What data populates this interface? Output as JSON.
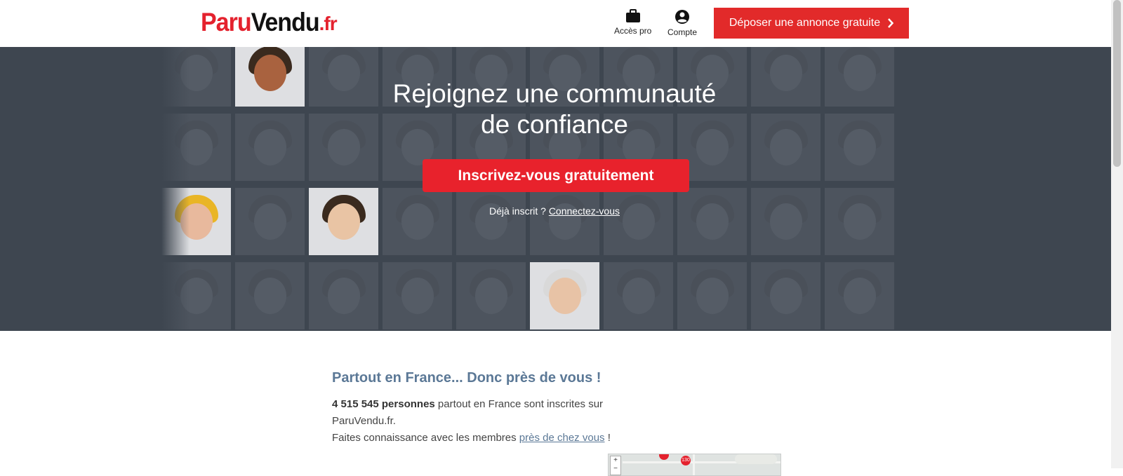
{
  "header": {
    "logo": {
      "part1": "Paru",
      "part2": "Vendu",
      "part3": ".fr"
    },
    "pro_label": "Accès pro",
    "account_label": "Compte",
    "deposit_label": "Déposer une annonce gratuite"
  },
  "hero": {
    "title_line1": "Rejoignez une communauté",
    "title_line2": "de confiance",
    "signup_label": "Inscrivez-vous gratuitement",
    "already_text": "Déjà inscrit ?",
    "login_link": "Connectez-vous"
  },
  "content": {
    "title": "Partout en France... Donc près de vous !",
    "count_bold": "4 515 545 personnes",
    "text1": " partout en France sont inscrites sur ParuVendu.fr.",
    "text2": "Faites connaissance avec les membres ",
    "link": "près de chez vous",
    "text3": " !",
    "map_pin": "130"
  },
  "colors": {
    "brand_red": "#e4222e",
    "hero_bg": "#3e4650",
    "title_blue": "#5b7896"
  }
}
